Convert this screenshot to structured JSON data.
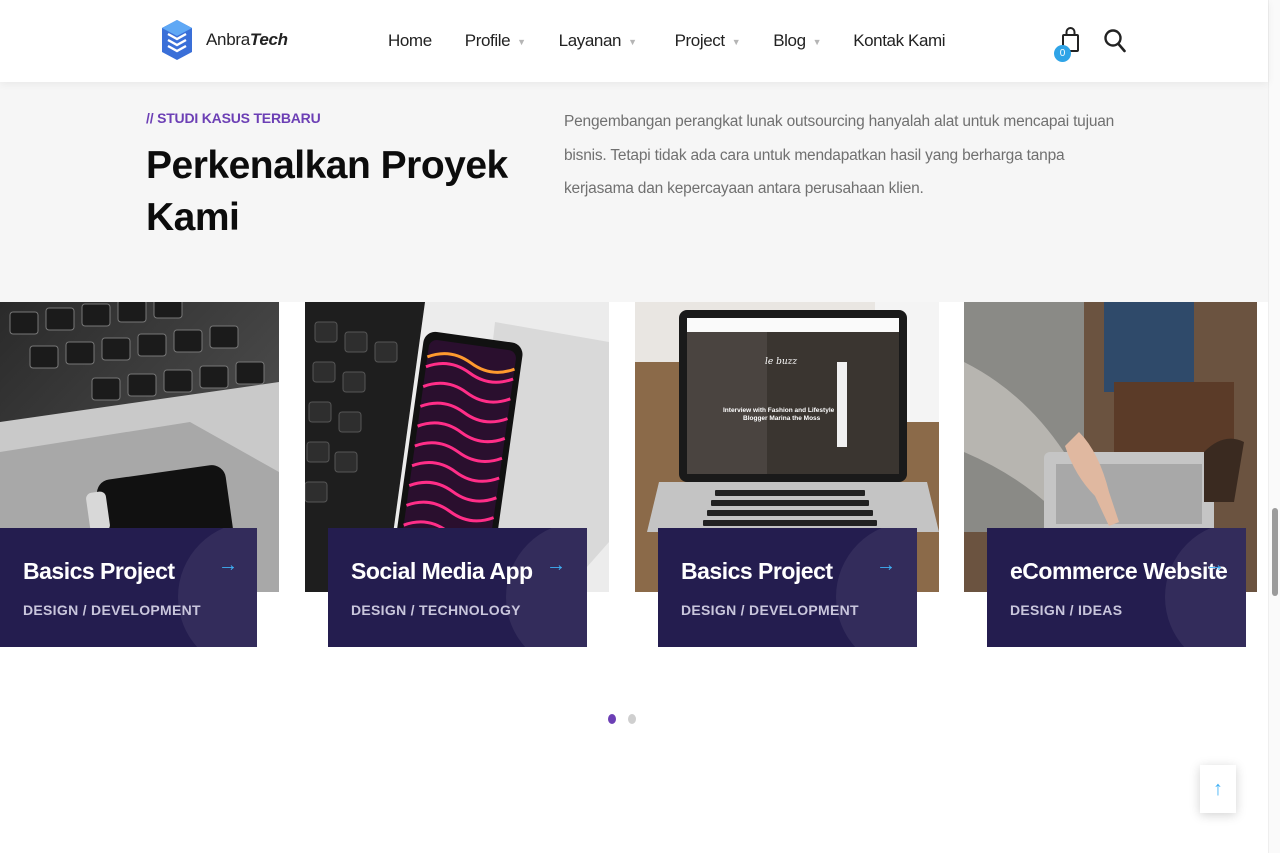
{
  "brand": {
    "name_plain": "Anbra",
    "name_italic": "Tech"
  },
  "nav": {
    "items": [
      {
        "label": "Home",
        "has_dropdown": false
      },
      {
        "label": "Profile",
        "has_dropdown": true
      },
      {
        "label": "Layanan",
        "has_dropdown": true
      },
      {
        "label": "Project",
        "has_dropdown": true
      },
      {
        "label": "Blog",
        "has_dropdown": true
      },
      {
        "label": "Kontak Kami",
        "has_dropdown": false
      }
    ],
    "dropdown_glyph": "▼"
  },
  "cart": {
    "count": "0",
    "icon": "shopping-bag-icon"
  },
  "search": {
    "icon": "search-icon"
  },
  "intro": {
    "kicker": "// STUDI KASUS TERBARU",
    "heading": "Perkenalkan Proyek Kami",
    "description": "Pengembangan perangkat lunak outsourcing hanyalah alat untuk mencapai tujuan bisnis. Tetapi tidak ada cara untuk mendapatkan hasil yang berharga tanpa kerjasama dan kepercayaan antara perusahaan klien."
  },
  "projects": [
    {
      "title": "Basics Project",
      "tags": "DESIGN /  DEVELOPMENT",
      "arrow": "→"
    },
    {
      "title": "Social Media App",
      "tags": "DESIGN /  TECHNOLOGY",
      "arrow": "→"
    },
    {
      "title": "Basics Project",
      "tags": "DESIGN /  DEVELOPMENT",
      "arrow": "→"
    },
    {
      "title": "eCommerce Website",
      "tags": "DESIGN /  IDEAS",
      "arrow": "→"
    }
  ],
  "laptop_screen": {
    "brand": "le buzz",
    "headline": "Interview with Fashion and Lifestyle Blogger Marina the Moss"
  },
  "pagination": {
    "pages": 2,
    "active": 1
  },
  "back_to_top": {
    "glyph": "↑"
  },
  "colors": {
    "accent_purple": "#6c3fb5",
    "card_overlay": "#241d4f",
    "arrow_blue": "#3fb0f5",
    "badge_blue": "#2fa4e7",
    "intro_bg": "#f6f6f6"
  }
}
